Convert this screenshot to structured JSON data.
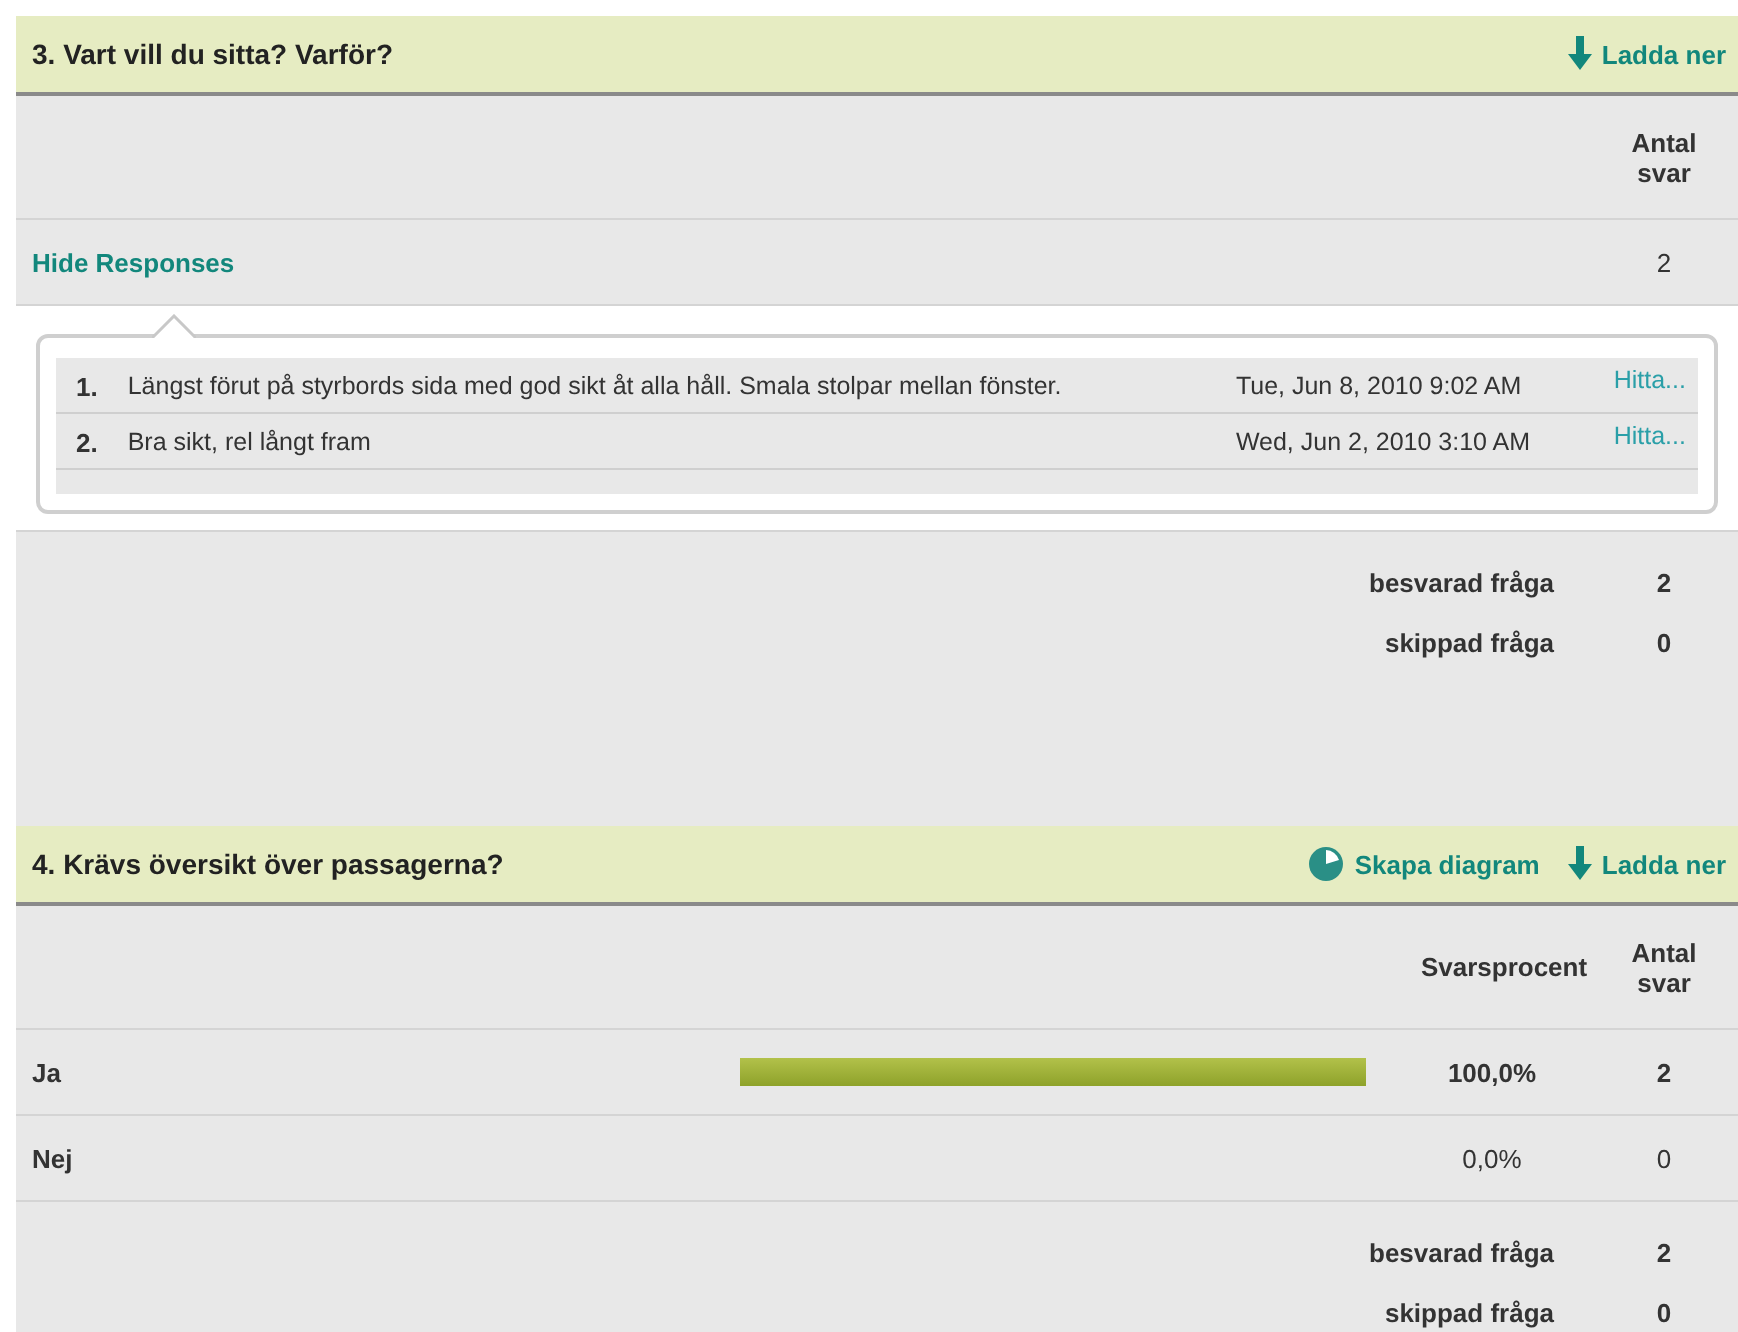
{
  "questions": [
    {
      "kind": "open",
      "title": "3. Vart vill du sitta? Varför?",
      "actions": [
        {
          "kind": "download",
          "label": "Ladda ner"
        }
      ],
      "columns": [
        "Antal svar"
      ],
      "toggle": {
        "label": "Hide Responses",
        "count": "2"
      },
      "responses": [
        {
          "number": "1.",
          "text": "Längst förut på styrbords sida med god sikt åt alla håll. Smala stolpar mellan fönster.",
          "date": "Tue, Jun 8, 2010 9:02 AM",
          "link": "Hitta..."
        },
        {
          "number": "2.",
          "text": "Bra sikt, rel långt fram",
          "date": "Wed, Jun 2, 2010 3:10 AM",
          "link": "Hitta..."
        }
      ],
      "summary": [
        {
          "label": "besvarad fråga",
          "value": "2"
        },
        {
          "label": "skippad fråga",
          "value": "0"
        }
      ]
    },
    {
      "kind": "choice",
      "title": "4. Krävs översikt över passagerna?",
      "actions": [
        {
          "kind": "chart",
          "label": "Skapa diagram"
        },
        {
          "kind": "download",
          "label": "Ladda ner"
        }
      ],
      "columns": [
        "Svarsprocent",
        "Antal svar"
      ],
      "options": [
        {
          "kind": "bar",
          "label": "Ja",
          "percent": "100,0%",
          "count": "2"
        },
        {
          "kind": "empty",
          "label": "Nej",
          "percent": "0,0%",
          "count": "0"
        }
      ],
      "summary": [
        {
          "label": "besvarad fråga",
          "value": "2"
        },
        {
          "label": "skippad fråga",
          "value": "0"
        }
      ]
    }
  ]
}
